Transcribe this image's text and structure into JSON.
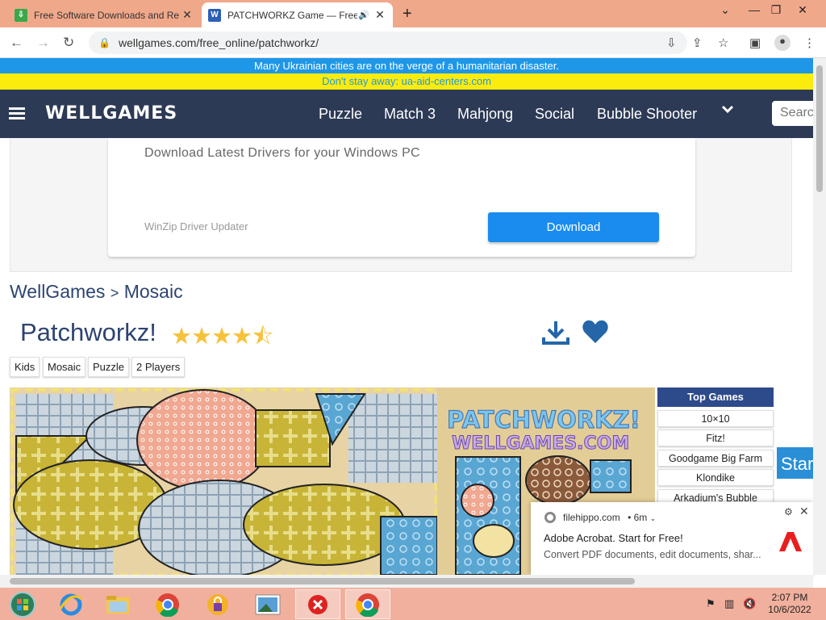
{
  "browser": {
    "tabs": [
      {
        "title": "Free Software Downloads and Re",
        "favicon": "filehippo-icon",
        "active": false
      },
      {
        "title": "PATCHWORKZ Game — Free",
        "favicon": "wellgames-icon",
        "active": true,
        "audio": true
      }
    ],
    "url": "wellgames.com/free_online/patchworkz/"
  },
  "banner": {
    "line1": "Many Ukrainian cities are on the verge of a humanitarian disaster.",
    "line2": "Don't stay away: ua-aid-centers.com"
  },
  "header": {
    "logo": "WELLGAMES",
    "menu": [
      "Puzzle",
      "Match 3",
      "Mahjong",
      "Social",
      "Bubble Shooter"
    ],
    "search_placeholder": "Search"
  },
  "ad": {
    "title": "Download Latest Drivers for your Windows PC",
    "source": "WinZip Driver Updater",
    "button": "Download"
  },
  "breadcrumb": {
    "home": "WellGames",
    "sep": ">",
    "category": "Mosaic"
  },
  "game": {
    "title": "Patchworkz!",
    "rating_stars": 4.5,
    "rating_max": 5,
    "tags": [
      "Kids",
      "Mosaic",
      "Puzzle",
      "2 Players"
    ],
    "splash_title": "PATCHWORKZ!",
    "splash_subtitle": "WELLGAMES.COM"
  },
  "top_games": {
    "heading": "Top Games",
    "items": [
      "10×10",
      "Fitz!",
      "Goodgame Big Farm",
      "Klondike",
      "Arkadium's Bubble"
    ]
  },
  "side_button": "Start",
  "notification": {
    "source": "filehippo.com",
    "time": "• 6m",
    "title": "Adobe Acrobat. Start for Free!",
    "body": "Convert PDF documents, edit documents, shar..."
  },
  "taskbar": {
    "apps": [
      "start-orb",
      "internet-explorer-icon",
      "file-explorer-icon",
      "chrome-icon",
      "security-app-icon",
      "photos-icon",
      "error-app-icon",
      "chrome-active-icon"
    ],
    "time": "2:07 PM",
    "date": "10/6/2022"
  },
  "colors": {
    "header_bg": "#2d3a55",
    "banner_blue": "#1e97e8",
    "banner_yellow": "#fcec0e",
    "accent_blue": "#1a8cf0",
    "star": "#f6c23c"
  }
}
